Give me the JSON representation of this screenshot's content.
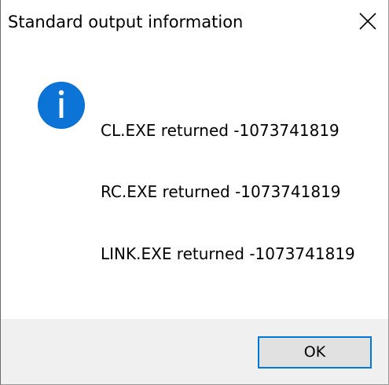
{
  "dialog": {
    "title": "Standard output information",
    "icon": "info-icon",
    "messages": [
      "CL.EXE returned -1073741819",
      "RC.EXE returned -1073741819",
      "LINK.EXE returned -1073741819"
    ],
    "ok_label": "OK",
    "close_icon": "close-icon"
  },
  "colors": {
    "accent": "#0078d7",
    "footer_bg": "#f0f0f0",
    "button_bg": "#e1e1e1"
  }
}
